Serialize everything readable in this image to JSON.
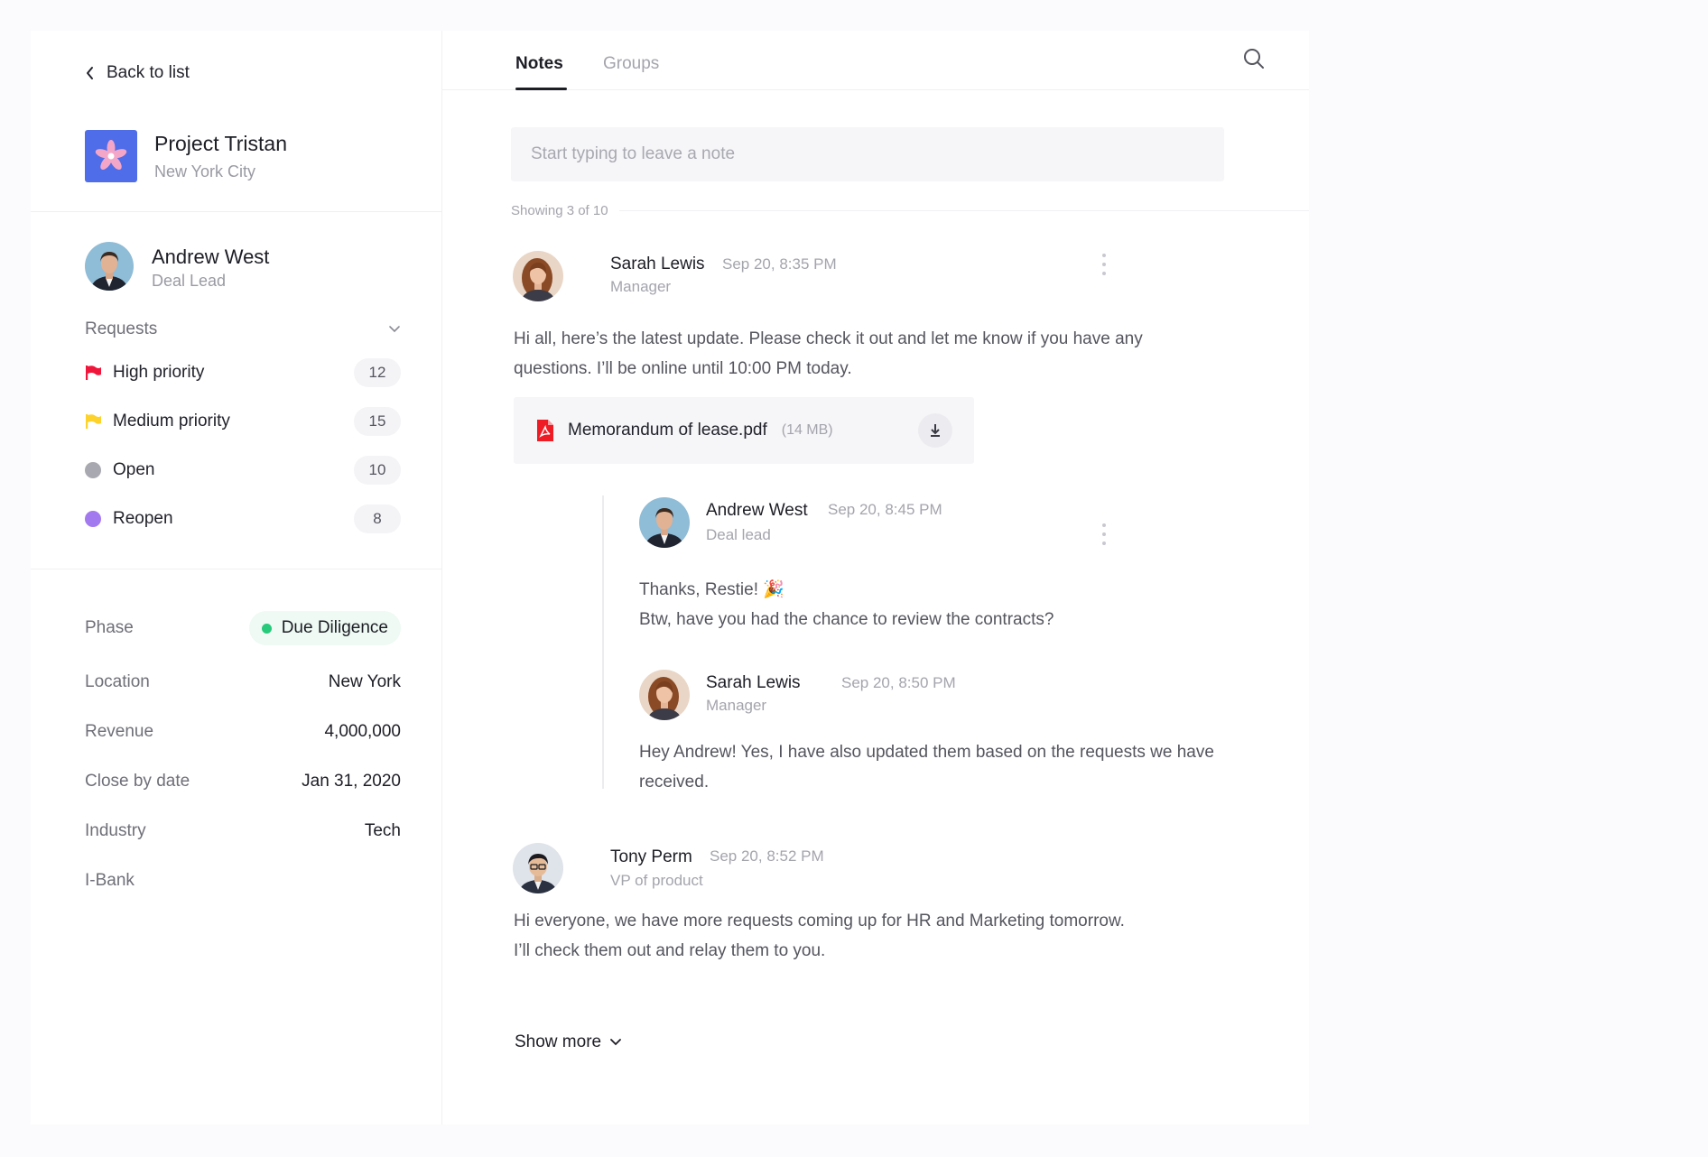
{
  "sidebar": {
    "back_label": "Back to list",
    "project": {
      "title": "Project Tristan",
      "subtitle": "New York City"
    },
    "lead": {
      "name": "Andrew West",
      "role": "Deal Lead"
    },
    "requests_label": "Requests",
    "requests": [
      {
        "label": "High priority",
        "count": "12",
        "icon": "red-flag-icon",
        "color": "#f0163b"
      },
      {
        "label": "Medium priority",
        "count": "15",
        "icon": "yellow-flag-icon",
        "color": "#fdd32b"
      },
      {
        "label": "Open",
        "count": "10",
        "icon": "gray-dot-icon",
        "color": "#a8a8b0"
      },
      {
        "label": "Reopen",
        "count": "8",
        "icon": "purple-dot-icon",
        "color": "#a379f0"
      }
    ],
    "properties": {
      "phase": {
        "key": "Phase",
        "value": "Due Diligence",
        "color": "#27c97a"
      },
      "location": {
        "key": "Location",
        "value": "New York"
      },
      "revenue": {
        "key": "Revenue",
        "value": "4,000,000"
      },
      "close_date": {
        "key": "Close by date",
        "value": "Jan 31, 2020"
      },
      "industry": {
        "key": "Industry",
        "value": "Tech"
      },
      "ibank": {
        "key": "I-Bank",
        "value": ""
      }
    }
  },
  "main": {
    "tabs": [
      {
        "label": "Notes",
        "active": true
      },
      {
        "label": "Groups",
        "active": false
      }
    ],
    "note_placeholder": "Start typing to leave a note",
    "showing": "Showing 3 of 10",
    "notes": [
      {
        "name": "Sarah Lewis",
        "role": "Manager",
        "time": "Sep 20, 8:35 PM",
        "text": "Hi all, here’s the latest update. Please check it out and let me know if you have any questions. I’ll be online until 10:00 PM today.",
        "attachment": {
          "name": "Memorandum of lease.pdf",
          "size": "(14 MB)"
        },
        "replies": [
          {
            "name": "Andrew West",
            "role": "Deal lead",
            "time": "Sep 20, 8:45 PM",
            "line1": "Thanks, Restie! 🎉",
            "line2": "Btw, have you had the chance to review the contracts?"
          },
          {
            "name": "Sarah Lewis",
            "role": "Manager",
            "time": "Sep 20, 8:50 PM",
            "text": "Hey Andrew! Yes, I have also updated them based on the requests we have received."
          }
        ]
      },
      {
        "name": "Tony Perm",
        "role": "VP of product",
        "time": "Sep 20, 8:52 PM",
        "text": "Hi everyone, we have more requests coming up for HR and Marketing tomorrow. I’ll check them out and relay them to you."
      }
    ],
    "show_more": "Show more"
  }
}
